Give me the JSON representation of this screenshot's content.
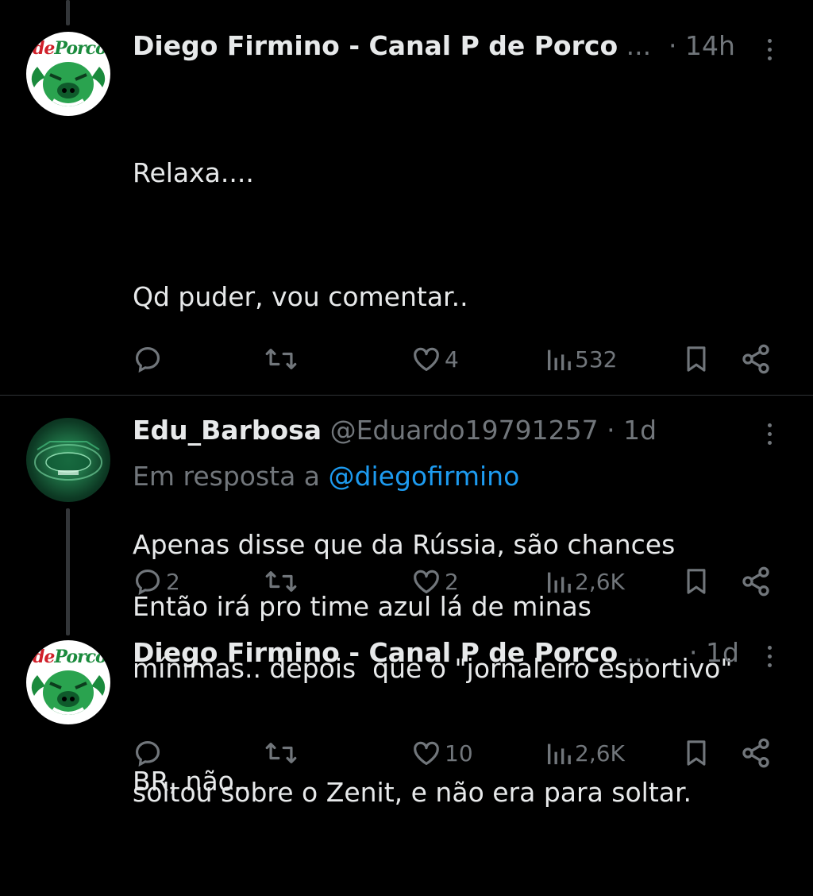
{
  "tweets": [
    {
      "name": "Diego Firmino - Canal P de Porco",
      "ellipsis": "...",
      "time": "· 14h",
      "avatar_logo": {
        "de": "de",
        "porco": "Porco"
      },
      "lines": [
        "Relaxa....",
        "Qd puder, vou comentar..",
        "",
        "Apenas disse que da Rússia, são chances",
        "mínimas.. depois  que o \"jornaleiro esportivo\"",
        "soltou sobre o Zenit, e não era para soltar."
      ],
      "actions": {
        "replies": "",
        "retweets": "",
        "likes": "4",
        "views": "532"
      }
    },
    {
      "name": "Edu_Barbosa",
      "handle": "@Eduardo19791257",
      "time": "· 1d",
      "reply_prefix": "Em resposta a",
      "reply_mention": "@diegofirmino",
      "lines": [
        "Então irá pro time azul lá de minas"
      ],
      "actions": {
        "replies": "2",
        "retweets": "",
        "likes": "2",
        "views": "2,6K"
      }
    },
    {
      "name": "Diego Firmino - Canal P de Porco",
      "ellipsis": "...",
      "time": "· 1d",
      "avatar_logo": {
        "de": "de",
        "porco": "Porco"
      },
      "lines": [
        "BR, não.."
      ],
      "actions": {
        "replies": "",
        "retweets": "",
        "likes": "10",
        "views": "2,6K"
      }
    }
  ],
  "colors": {
    "background": "#000000",
    "text": "#e7e9ea",
    "muted": "#71767b",
    "link": "#1d9bf0"
  },
  "icons": [
    "reply-icon",
    "retweet-icon",
    "like-icon",
    "views-icon",
    "bookmark-icon",
    "share-icon",
    "more-icon"
  ]
}
